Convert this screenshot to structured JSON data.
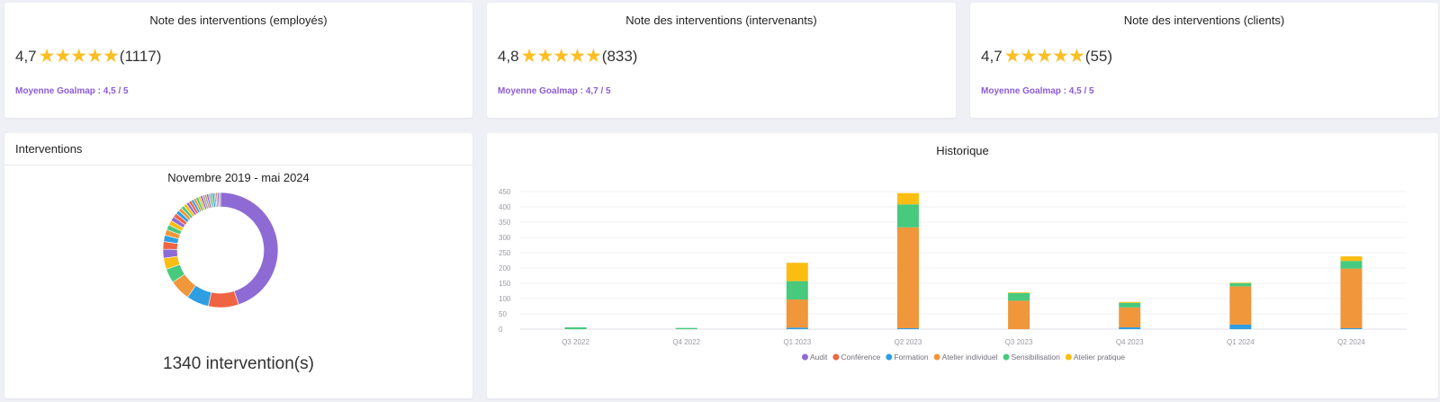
{
  "ratings": [
    {
      "title": "Note des interventions (employés)",
      "score": "4,7",
      "stars": "★★★★★",
      "count": "(1117)",
      "average": "Moyenne Goalmap : 4,5 / 5"
    },
    {
      "title": "Note des interventions (intervenants)",
      "score": "4,8",
      "stars": "★★★★★",
      "count": "(833)",
      "average": "Moyenne Goalmap : 4,7 / 5"
    },
    {
      "title": "Note des interventions (clients)",
      "score": "4,7",
      "stars": "★★★★★",
      "count": "(55)",
      "average": "Moyenne Goalmap : 4,5 / 5"
    }
  ],
  "interventions": {
    "header": "Interventions",
    "period": "Novembre 2019 - mai 2024",
    "total": "1340 intervention(s)",
    "donut": {
      "segments": [
        {
          "value": 500,
          "color": "#8e6bd4"
        },
        {
          "value": 95,
          "color": "#ef6443"
        },
        {
          "value": 70,
          "color": "#2f9ee3"
        },
        {
          "value": 65,
          "color": "#f0963b"
        },
        {
          "value": 45,
          "color": "#47c97e"
        },
        {
          "value": 35,
          "color": "#fbbd12"
        },
        {
          "value": 28,
          "color": "#8e6bd4"
        },
        {
          "value": 24,
          "color": "#ef6443"
        },
        {
          "value": 20,
          "color": "#2f9ee3"
        },
        {
          "value": 18,
          "color": "#f0963b"
        },
        {
          "value": 16,
          "color": "#47c97e"
        },
        {
          "value": 15,
          "color": "#fbbd12"
        },
        {
          "value": 14,
          "color": "#8e6bd4"
        },
        {
          "value": 13,
          "color": "#ef6443"
        },
        {
          "value": 12,
          "color": "#2f9ee3"
        },
        {
          "value": 11,
          "color": "#f0963b"
        },
        {
          "value": 10,
          "color": "#47c97e"
        },
        {
          "value": 10,
          "color": "#fbbd12"
        },
        {
          "value": 9,
          "color": "#8e6bd4"
        },
        {
          "value": 9,
          "color": "#ef6443"
        },
        {
          "value": 8,
          "color": "#2f9ee3"
        },
        {
          "value": 8,
          "color": "#f0963b"
        },
        {
          "value": 8,
          "color": "#47c97e"
        },
        {
          "value": 7,
          "color": "#fbbd12"
        },
        {
          "value": 7,
          "color": "#8e6bd4"
        },
        {
          "value": 7,
          "color": "#a3a3a3"
        },
        {
          "value": 6,
          "color": "#c48f6a"
        },
        {
          "value": 6,
          "color": "#8e6bd4"
        },
        {
          "value": 6,
          "color": "#a3a3a3"
        },
        {
          "value": 6,
          "color": "#47c97e"
        },
        {
          "value": 6,
          "color": "#2f9ee3"
        },
        {
          "value": 5,
          "color": "#a3a3a3"
        },
        {
          "value": 5,
          "color": "#c48f6a"
        },
        {
          "value": 5,
          "color": "#8e6bd4"
        },
        {
          "value": 5,
          "color": "#a3a3a3"
        }
      ]
    }
  },
  "history": {
    "title": "Historique",
    "chart_data": {
      "type": "bar",
      "stacked": true,
      "categories": [
        "Q3 2022",
        "Q4 2022",
        "Q1 2023",
        "Q2 2023",
        "Q3 2023",
        "Q4 2023",
        "Q1 2024",
        "Q2 2024"
      ],
      "ylim": [
        0,
        450
      ],
      "yticks": [
        0,
        50,
        100,
        150,
        200,
        250,
        300,
        350,
        400,
        450
      ],
      "grid": true,
      "legend_position": "bottom",
      "series": [
        {
          "name": "Audit",
          "color": "#8e6bd4",
          "values": [
            0,
            0,
            0,
            0,
            0,
            0,
            0,
            0
          ]
        },
        {
          "name": "Conférence",
          "color": "#ef6443",
          "values": [
            0,
            0,
            0,
            0,
            0,
            0,
            0,
            0
          ]
        },
        {
          "name": "Formation",
          "color": "#2f9ee3",
          "values": [
            0,
            0,
            5,
            3,
            0,
            6,
            15,
            3
          ]
        },
        {
          "name": "Atelier individuel",
          "color": "#f0963b",
          "values": [
            0,
            0,
            92,
            330,
            93,
            65,
            125,
            195
          ]
        },
        {
          "name": "Sensibilisation",
          "color": "#47c97e",
          "values": [
            6,
            4,
            60,
            75,
            25,
            15,
            10,
            25
          ]
        },
        {
          "name": "Atelier pratique",
          "color": "#fbbd12",
          "values": [
            0,
            0,
            60,
            37,
            2,
            3,
            2,
            15
          ]
        }
      ]
    }
  }
}
